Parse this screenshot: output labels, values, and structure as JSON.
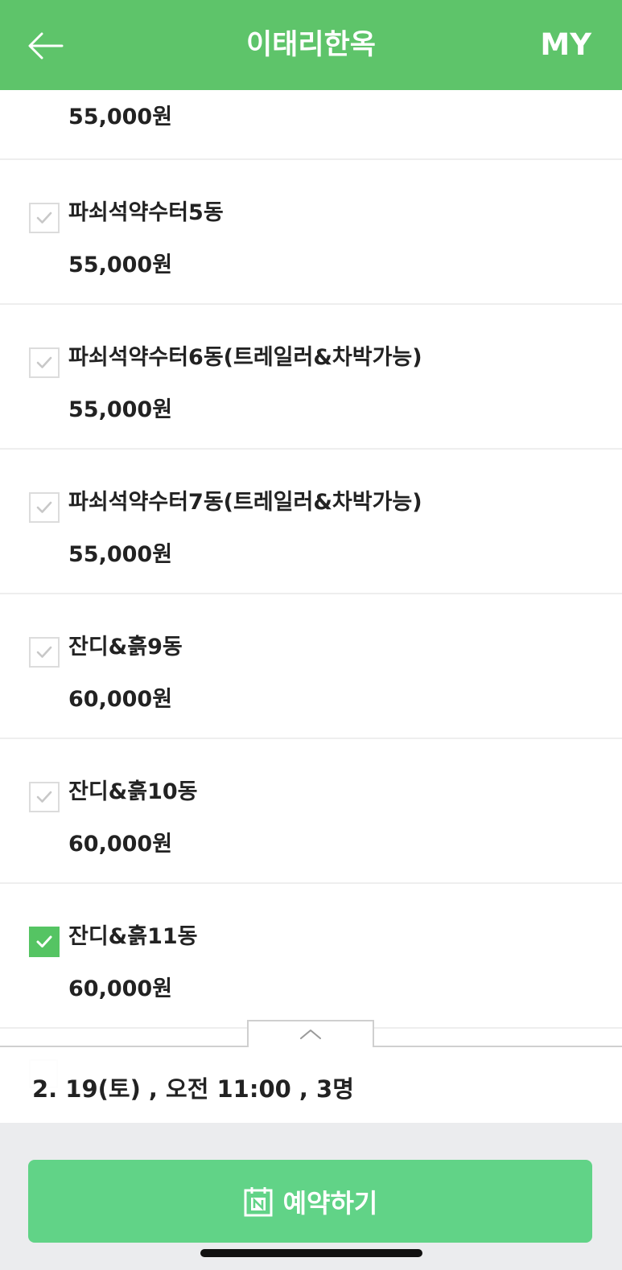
{
  "header": {
    "title": "이태리한옥",
    "my_label": "MY"
  },
  "items": [
    {
      "name": "",
      "price": "55,000원",
      "checked": false
    },
    {
      "name": "파쇠석약수터5동",
      "price": "55,000원",
      "checked": false
    },
    {
      "name": "파쇠석약수터6동(트레일러&차박가능)",
      "price": "55,000원",
      "checked": false
    },
    {
      "name": "파쇠석약수터7동(트레일러&차박가능)",
      "price": "55,000원",
      "checked": false
    },
    {
      "name": "잔디&흙9동",
      "price": "60,000원",
      "checked": false
    },
    {
      "name": "잔디&흙10동",
      "price": "60,000원",
      "checked": false
    },
    {
      "name": "잔디&흙11동",
      "price": "60,000원",
      "checked": true
    }
  ],
  "summary": {
    "text": "2. 19(토) , 오전 11:00 , 3명"
  },
  "reserve_button": {
    "label": "예약하기"
  },
  "colors": {
    "header": "#5ec46a",
    "checkbox_checked": "#55c463",
    "reserve_button": "#61d387",
    "bottom_bar": "#ebecee"
  },
  "icons": {
    "back": "arrow-left-icon",
    "checkbox": "checkmark-icon",
    "toggle": "chevron-up-icon",
    "reserve": "naver-calendar-icon"
  }
}
